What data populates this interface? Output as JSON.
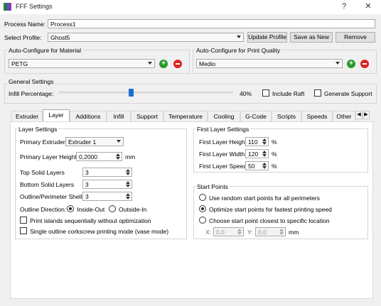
{
  "window": {
    "title": "FFF Settings"
  },
  "titlebar": {
    "help": "?",
    "close": "✕"
  },
  "process": {
    "label": "Process Name:",
    "value": "Process1"
  },
  "profile": {
    "label": "Select Profile:",
    "value": "Ghost5",
    "update": "Update Profile",
    "save_as_new": "Save as New",
    "remove": "Remove"
  },
  "material": {
    "title": "Auto-Configure for Material",
    "value": "PETG"
  },
  "quality": {
    "title": "Auto-Configure for Print Quality",
    "value": "Medio"
  },
  "general": {
    "title": "General Settings",
    "infill_label": "Infill Percentage:",
    "infill_value": "40%",
    "infill_fraction": 0.4,
    "include_raft": "Include Raft",
    "generate_support": "Generate Support"
  },
  "tabs": [
    "Extruder",
    "Layer",
    "Additions",
    "Infill",
    "Support",
    "Temperature",
    "Cooling",
    "G-Code",
    "Scripts",
    "Speeds",
    "Other"
  ],
  "active_tab": "Layer",
  "layer_settings": {
    "title": "Layer Settings",
    "primary_extruder_label": "Primary Extruder",
    "primary_extruder_value": "Extruder 1",
    "primary_layer_height_label": "Primary Layer Height",
    "primary_layer_height_value": "0,2000",
    "primary_layer_height_unit": "mm",
    "top_solid_label": "Top Solid Layers",
    "top_solid_value": "3",
    "bottom_solid_label": "Bottom Solid Layers",
    "bottom_solid_value": "3",
    "outline_shells_label": "Outline/Perimeter Shells",
    "outline_shells_value": "3",
    "outline_direction_label": "Outline Direction:",
    "inside_out": "Inside-Out",
    "outside_in": "Outside-In",
    "print_islands": "Print islands sequentially without optimization",
    "single_outline": "Single outline corkscrew printing mode (vase mode)"
  },
  "first_layer": {
    "title": "First Layer Settings",
    "height_label": "First Layer Height",
    "height_value": "110",
    "width_label": "First Layer Width",
    "width_value": "120",
    "speed_label": "First Layer Speed",
    "speed_value": "50",
    "unit": "%"
  },
  "start_points": {
    "title": "Start Points",
    "random": "Use random start points for all perimeters",
    "optimize": "Optimize start points for fastest printing speed",
    "closest": "Choose start point closest to specific location",
    "x_label": "X:",
    "x_value": "0,0",
    "y_label": "Y:",
    "y_value": "0,0",
    "unit": "mm"
  },
  "colors": {
    "accent": "#1e6ecf",
    "add": "#2c9a2c",
    "remove": "#dd2222"
  }
}
